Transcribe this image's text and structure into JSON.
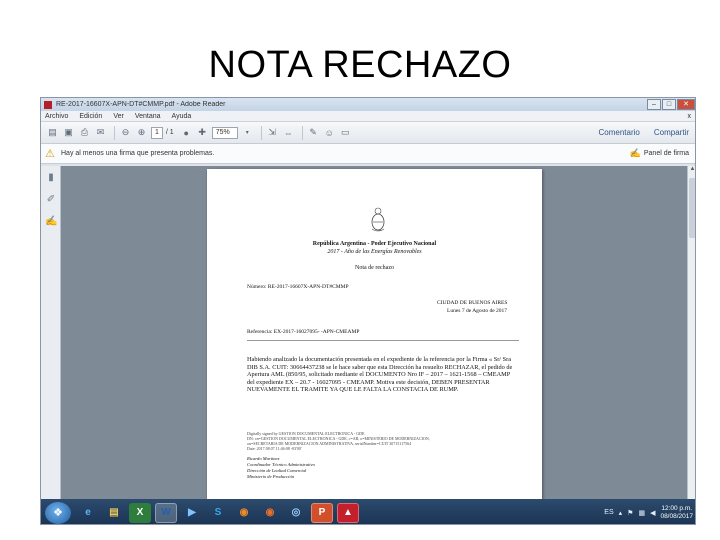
{
  "slide": {
    "title": "NOTA RECHAZO"
  },
  "window": {
    "title": "RE-2017-16607X-APN-DT#CMMP.pdf - Adobe Reader",
    "minimize": "–",
    "maximize": "□",
    "close": "✕"
  },
  "menu": {
    "items": [
      "Archivo",
      "Edición",
      "Ver",
      "Ventana",
      "Ayuda"
    ],
    "close_doc": "x"
  },
  "toolbar": {
    "page_current": "1",
    "page_total": "/ 1",
    "zoom": "75%",
    "comment_link": "Comentario",
    "share_link": "Compartir"
  },
  "notice": {
    "text": "Hay al menos una firma que presenta problemas.",
    "panel_label": "Panel de firma"
  },
  "document": {
    "header_line1": "República Argentina - Poder Ejecutivo Nacional",
    "header_line2": "2017 - Año de las Energías Renovables",
    "doc_type": "Nota de rechazo",
    "number_line": "Número: RE-2017-16607X-APN-DT#CMMP",
    "city": "CIUDAD DE BUENOS AIRES",
    "date": "Lunes 7 de Agosto de 2017",
    "reference_line": "Referencia: EX-2017-16027095- -APN-CMEAMP",
    "body": "Habiendo analizado la documentación presentada en el expediente de la referencia por la Firma « Sr/ Sra DIB S.A. CUIT: 30664437238 se le hace saber que esta Dirección ha resuelto RECHAZAR, el pedido de Apertura AML (850/95, solicitado mediante el DOCUMENTO Nro IF – 2017 – 1621-1568 – CMEAMP del expediente EX – 20.7 - 16027095 - CMEAMP. Motiva este decisión, DEBEN PRESENTAR NUEVAMENTE EL TRAMITE YA QUE LE FALTA LA CONSTACIA DE RUMP.",
    "signature_block_1": "Digitally signed by GESTION DOCUMENTAL ELECTRONICA - GDE",
    "signature_block_2": "DN: cn=GESTION DOCUMENTAL ELECTRONICA - GDE, c=AR, o=MINISTERIO DE MODERNIZACION,",
    "signature_block_3": "ou=SECRETARIA DE MODERNIZACION ADMINISTRATIVA, serialNumber=CUIT 30715117564",
    "signature_block_4": "Date: 2017.08.07 11:46:08 -03'00'",
    "signer_name": "Ricardo Martinez",
    "signer_role": "Coordinador Técnico Administrativo",
    "signer_dept": "Dirección de Lealtad Comercial",
    "signer_ministry": "Ministerio de Producción"
  },
  "taskbar": {
    "start_icon": "windows-start-icon",
    "tray_lang": "ES",
    "clock_time": "12:00 p.m.",
    "clock_date": "08/08/2017"
  }
}
